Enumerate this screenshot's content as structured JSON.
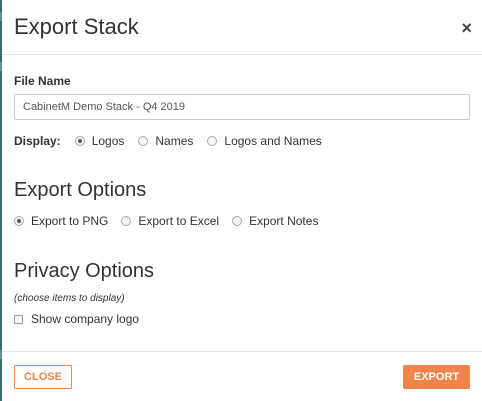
{
  "dialog": {
    "title": "Export Stack",
    "close_icon": "×"
  },
  "file_name": {
    "label": "File Name",
    "value": "CabinetM Demo Stack - Q4 2019"
  },
  "display": {
    "label": "Display:",
    "options": [
      {
        "label": "Logos",
        "checked": true
      },
      {
        "label": "Names",
        "checked": false
      },
      {
        "label": "Logos and Names",
        "checked": false
      }
    ]
  },
  "export_options": {
    "heading": "Export Options",
    "options": [
      {
        "label": "Export to PNG",
        "checked": true
      },
      {
        "label": "Export to Excel",
        "checked": false
      },
      {
        "label": "Export Notes",
        "checked": false
      }
    ]
  },
  "privacy_options": {
    "heading": "Privacy Options",
    "note": "(choose items to display)",
    "show_logo_label": "Show company logo",
    "show_logo_checked": false
  },
  "footer": {
    "close_label": "CLOSE",
    "export_label": "EXPORT"
  },
  "colors": {
    "accent": "#f0844a",
    "text": "#333333",
    "divider": "#e5e5e5"
  }
}
